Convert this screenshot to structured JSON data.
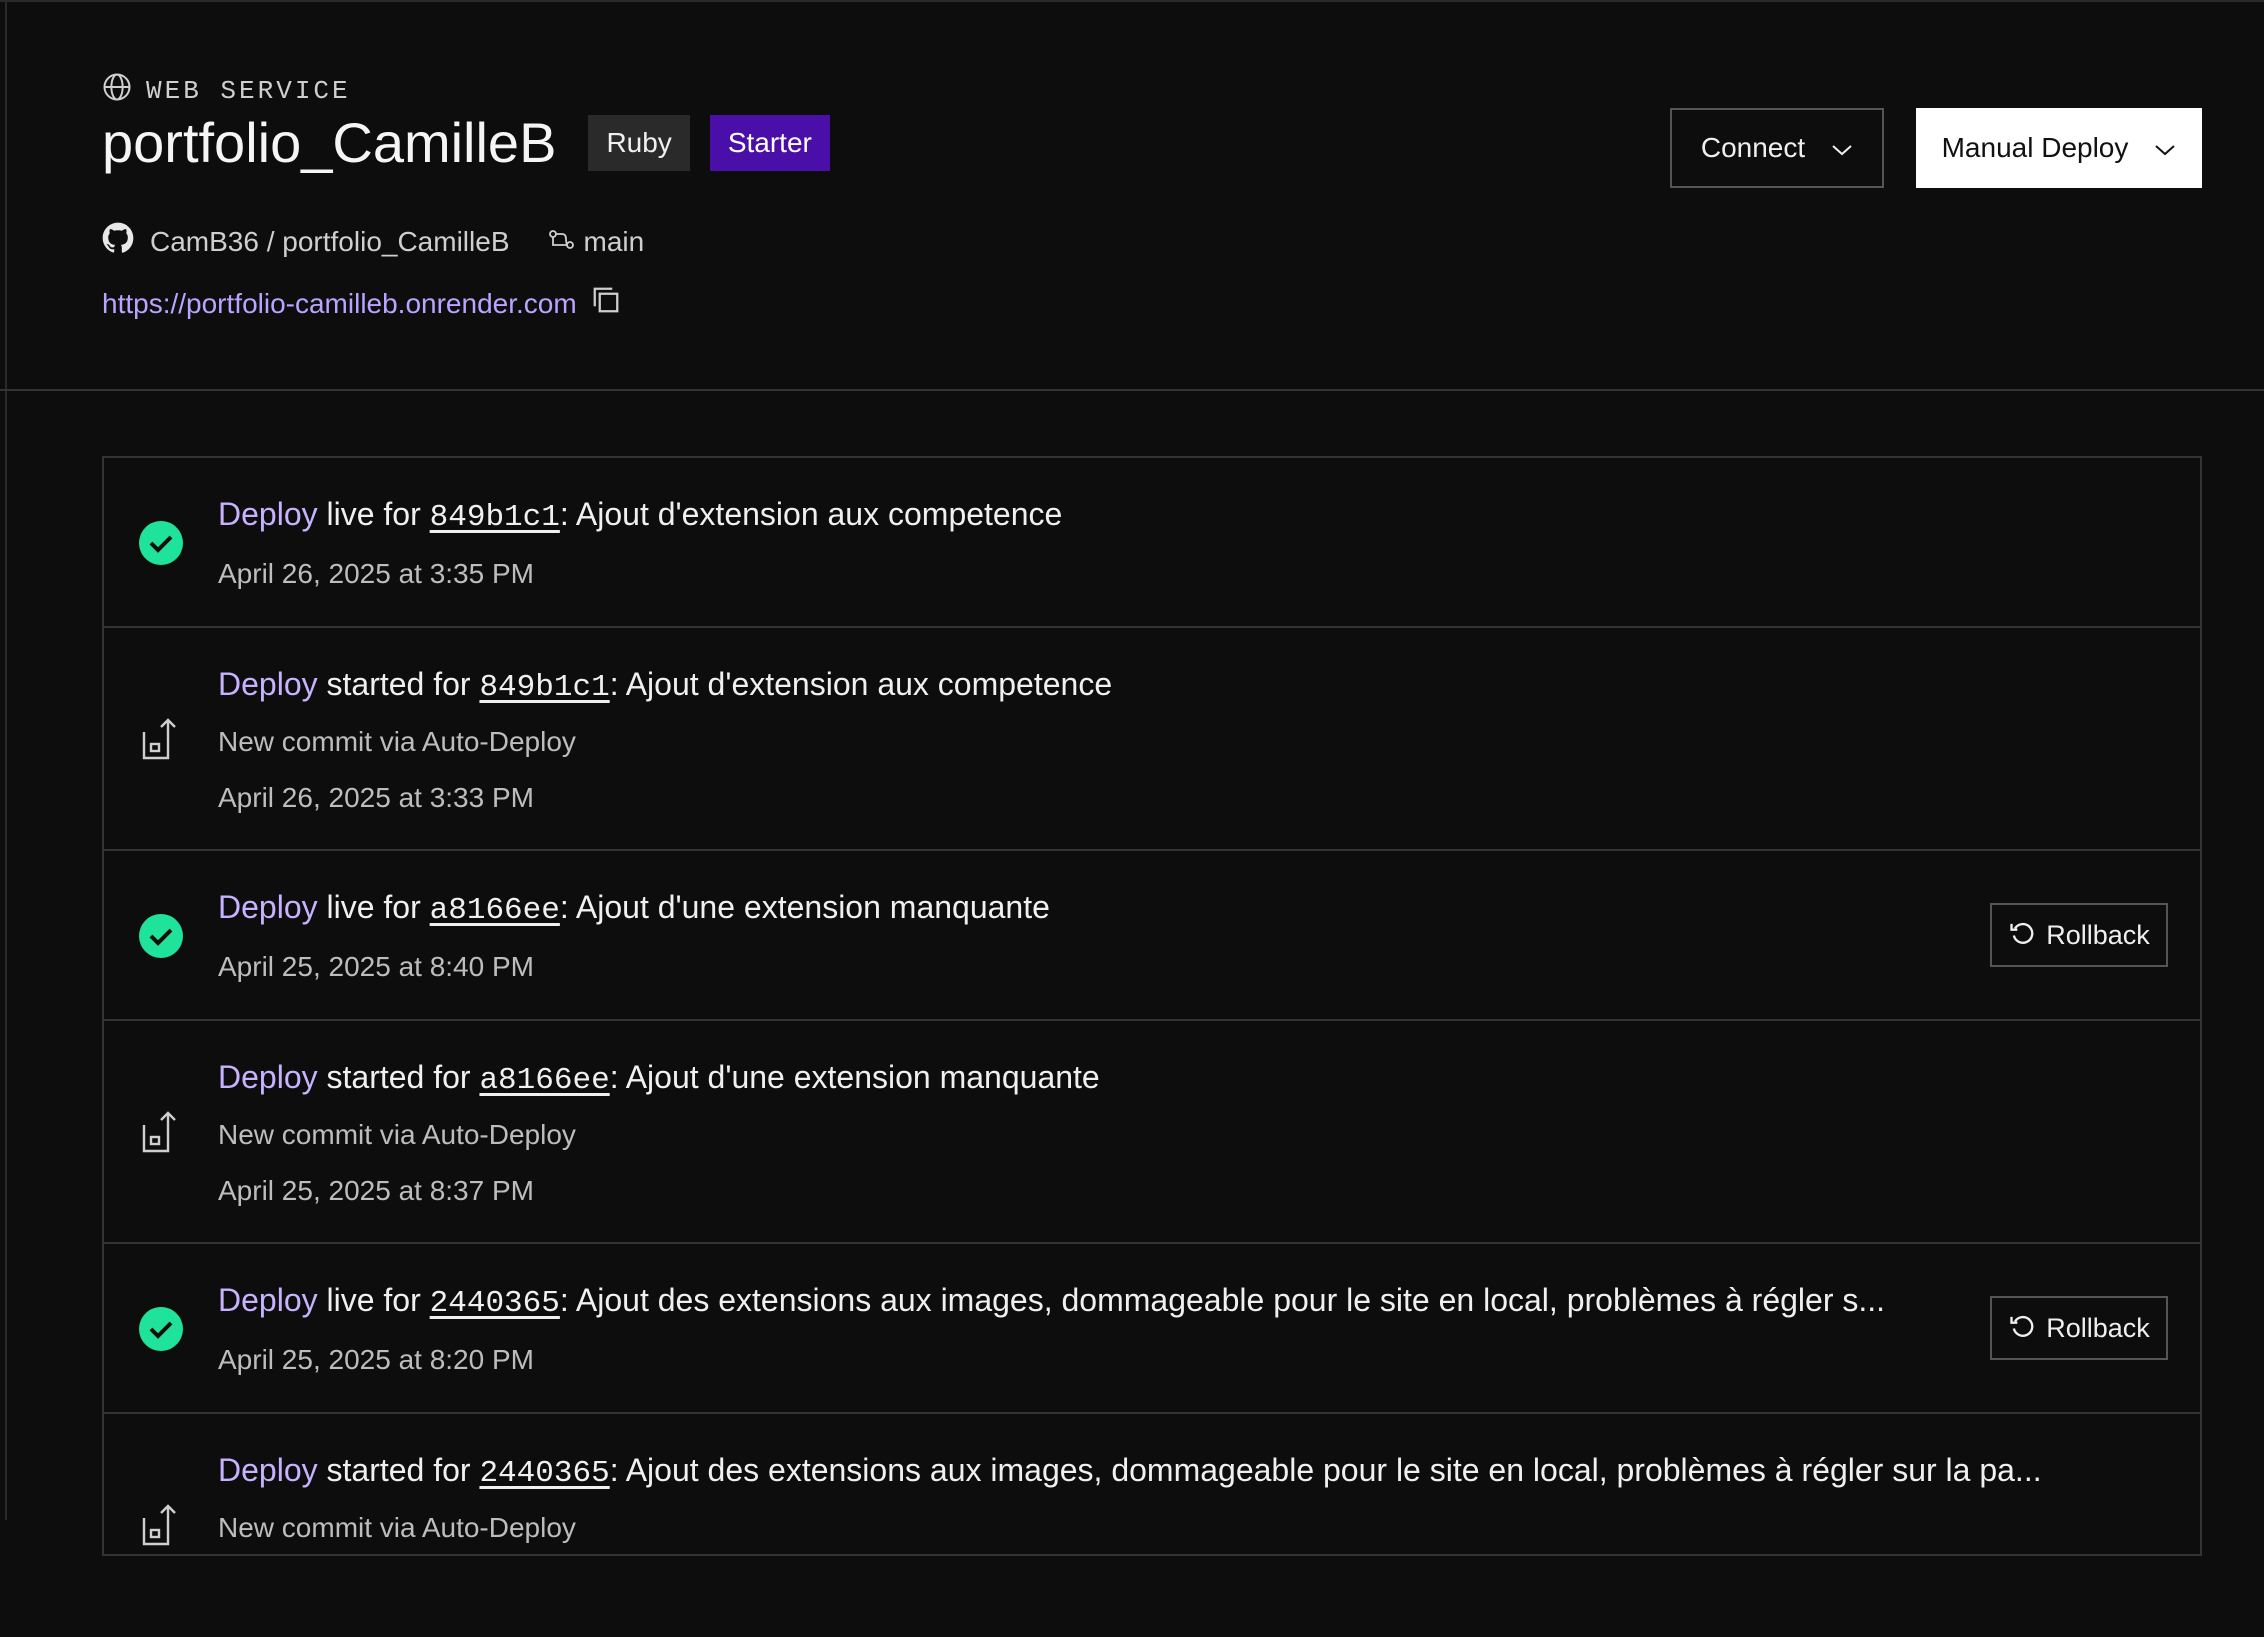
{
  "service": {
    "type_label": "WEB SERVICE",
    "name": "portfolio_CamilleB",
    "badges": [
      "Ruby",
      "Starter"
    ],
    "repo": "CamB36 / portfolio_CamilleB",
    "branch": "main",
    "url": "https://portfolio-camilleb.onrender.com"
  },
  "actions": {
    "connect_label": "Connect",
    "manual_deploy_label": "Manual Deploy"
  },
  "events": [
    {
      "kind": "live",
      "keyword": "Deploy",
      "verb": " live for ",
      "hash": "849b1c1",
      "message": ": Ajout d'extension aux competence",
      "sub": "",
      "date": "April 26, 2025 at 3:35 PM",
      "rollback": ""
    },
    {
      "kind": "started",
      "keyword": "Deploy",
      "verb": " started for ",
      "hash": "849b1c1",
      "message": ": Ajout d'extension aux competence",
      "sub": "New commit via Auto-Deploy",
      "date": "April 26, 2025 at 3:33 PM",
      "rollback": ""
    },
    {
      "kind": "live",
      "keyword": "Deploy",
      "verb": " live for ",
      "hash": "a8166ee",
      "message": ": Ajout d'une extension manquante",
      "sub": "",
      "date": "April 25, 2025 at 8:40 PM",
      "rollback": "Rollback"
    },
    {
      "kind": "started",
      "keyword": "Deploy",
      "verb": " started for ",
      "hash": "a8166ee",
      "message": ": Ajout d'une extension manquante",
      "sub": "New commit via Auto-Deploy",
      "date": "April 25, 2025 at 8:37 PM",
      "rollback": ""
    },
    {
      "kind": "live",
      "keyword": "Deploy",
      "verb": " live for ",
      "hash": "2440365",
      "message": ": Ajout des extensions aux images, dommageable pour le site en local, problèmes à régler s...",
      "sub": "",
      "date": "April 25, 2025 at 8:20 PM",
      "rollback": "Rollback"
    },
    {
      "kind": "started",
      "keyword": "Deploy",
      "verb": " started for ",
      "hash": "2440365",
      "message": ": Ajout des extensions aux images, dommageable pour le site en local, problèmes à régler sur la pa...",
      "sub": "New commit via Auto-Deploy",
      "date": "",
      "rollback": ""
    }
  ],
  "colors": {
    "accent": "#c7b2ff",
    "success": "#1fe39a",
    "starter": "#4a0fa8",
    "link": "#b9a4ff"
  }
}
